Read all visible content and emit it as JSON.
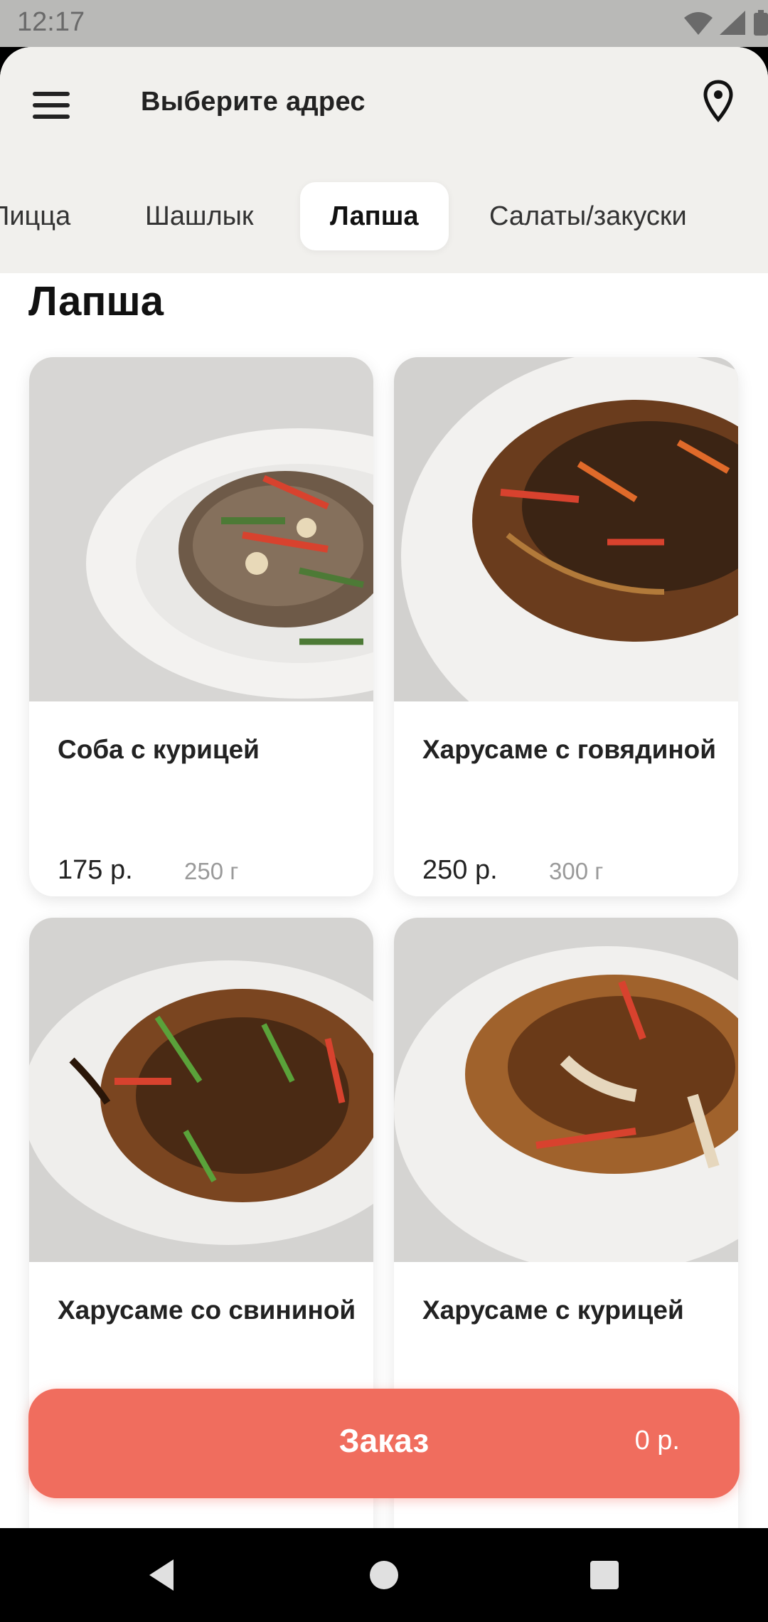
{
  "status_bar": {
    "time": "12:17"
  },
  "header": {
    "address": "Выберите адрес",
    "menu_icon": "menu-icon",
    "location_icon": "location-pin-icon"
  },
  "tabs": [
    {
      "label": "Пицца",
      "active": false
    },
    {
      "label": "Шашлык",
      "active": false
    },
    {
      "label": "Лапша",
      "active": true
    },
    {
      "label": "Салаты/закуски",
      "active": false
    }
  ],
  "section": {
    "title": "Лапша"
  },
  "products": [
    {
      "name": "Соба с курицей",
      "price": "175 р.",
      "weight": "250 г"
    },
    {
      "name": "Харусаме с говядиной",
      "price": "250 р.",
      "weight": "300 г"
    },
    {
      "name": "Харусаме со свининой",
      "price": "",
      "weight": ""
    },
    {
      "name": "Харусаме с курицей",
      "price": "",
      "weight": ""
    }
  ],
  "order": {
    "label": "Заказ",
    "total": "0 р."
  },
  "colors": {
    "accent": "#f06d5e",
    "header_bg": "#f1f0ed",
    "status_bg": "#b9b9b7"
  },
  "nav_bar": {
    "icons": [
      "back-icon",
      "home-icon",
      "recents-icon"
    ]
  }
}
